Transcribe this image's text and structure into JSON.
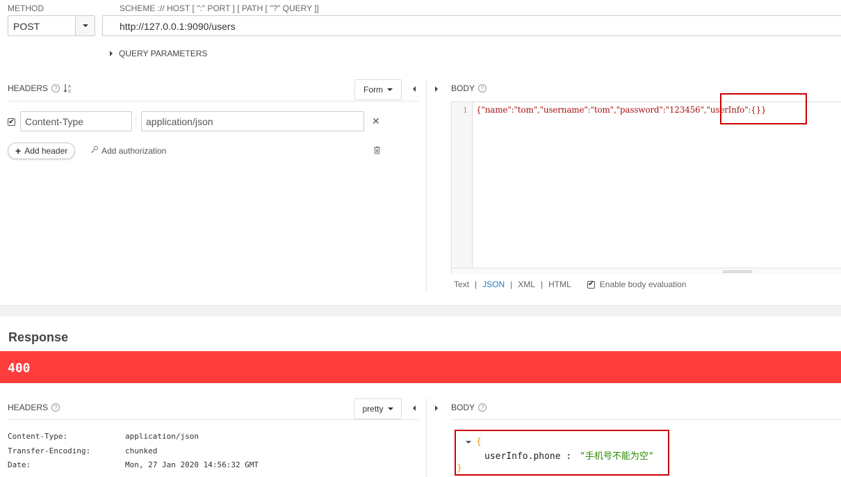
{
  "request": {
    "method_label": "METHOD",
    "method_value": "POST",
    "url_label": "SCHEME :// HOST [ \":\" PORT ] [ PATH [ \"?\" QUERY ]]",
    "url_value": "http://127.0.0.1:9090/users",
    "query_params_label": "QUERY PARAMETERS",
    "headers": {
      "title": "HEADERS",
      "mode_button": "Form",
      "rows": [
        {
          "checked": true,
          "name": "Content-Type",
          "value": "application/json"
        }
      ],
      "add_header_label": "Add header",
      "add_authorization_label": "Add authorization"
    },
    "body": {
      "title": "BODY",
      "line_number": "1",
      "code_prefix": "{\"name\":\"tom\",\"username\":\"tom\",\"password\":\"123456\",",
      "code_highlight": "\"userInfo\":{}}",
      "types": [
        "Text",
        "JSON",
        "XML",
        "HTML"
      ],
      "active_type": "JSON",
      "enable_eval_label": "Enable body evaluation",
      "enable_eval_checked": true
    }
  },
  "response": {
    "title": "Response",
    "status": "400",
    "status_color": "#ff3c3c",
    "headers": {
      "title": "HEADERS",
      "mode_button": "pretty",
      "rows": [
        {
          "key": "Content-Type:",
          "value": "application/json"
        },
        {
          "key": "Transfer-Encoding:",
          "value": "chunked"
        },
        {
          "key": "Date:",
          "value": "Mon, 27 Jan 2020 14:56:32 GMT"
        }
      ]
    },
    "body": {
      "title": "BODY",
      "open_brace": "{",
      "key": "userInfo.phone",
      "separator": ":",
      "value": "\"手机号不能为空\"",
      "close_brace": "}"
    }
  },
  "icons": {
    "sort": "sort-alpha-icon",
    "help": "help-circle-icon",
    "plus": "plus-icon",
    "key": "key-icon",
    "close": "close-icon",
    "trash": "trash-icon"
  }
}
